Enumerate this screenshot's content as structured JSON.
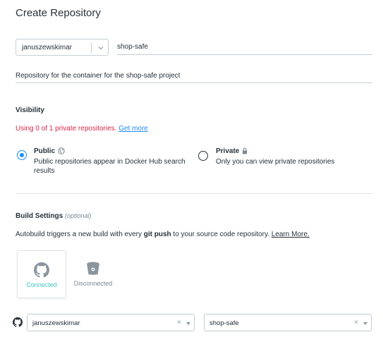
{
  "page": {
    "title": "Create Repository"
  },
  "form": {
    "namespace": "januszewskimar",
    "repo_name": "shop-safe",
    "description": "Repository for the container for the shop-safe project"
  },
  "visibility": {
    "heading": "Visibility",
    "private_note_text": "Using 0 of 1 private repositories.",
    "private_note_link": "Get more",
    "options": [
      {
        "label": "Public",
        "description": "Public repositories appear in Docker Hub search results",
        "icon": "globe-icon",
        "selected": true
      },
      {
        "label": "Private",
        "description": "Only you can view private repositories",
        "icon": "lock-icon",
        "selected": false
      }
    ]
  },
  "build": {
    "heading": "Build Settings",
    "optional": "(optional)",
    "autobuild_pre": "Autobuild triggers a new build with every ",
    "autobuild_bold": "git push",
    "autobuild_post": " to your source code repository.",
    "learn_more": "Learn More.",
    "providers": [
      {
        "name": "GitHub",
        "icon": "github-icon",
        "status": "Connected",
        "selected": true
      },
      {
        "name": "Bitbucket",
        "icon": "bitbucket-icon",
        "status": "Disconnected",
        "selected": false
      }
    ],
    "org_select": {
      "value": "januszewskimar",
      "clear": "×"
    },
    "repo_select": {
      "value": "shop-safe",
      "clear": "×"
    }
  },
  "colors": {
    "accent": "#1d8cf8",
    "connected": "#3ec7c2",
    "warning": "#d8274b",
    "text": "#27313b"
  }
}
